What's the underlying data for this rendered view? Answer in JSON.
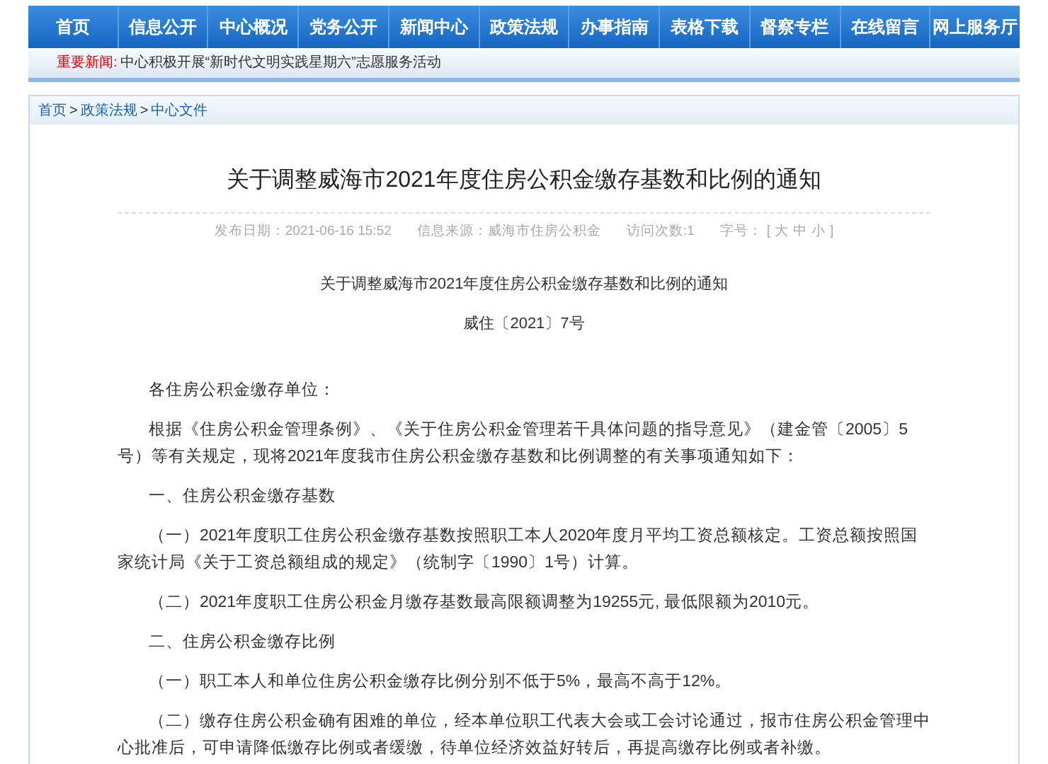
{
  "nav": [
    {
      "label": "首页"
    },
    {
      "label": "信息公开"
    },
    {
      "label": "中心概况"
    },
    {
      "label": "党务公开"
    },
    {
      "label": "新闻中心"
    },
    {
      "label": "政策法规"
    },
    {
      "label": "办事指南"
    },
    {
      "label": "表格下载"
    },
    {
      "label": "督察专栏"
    },
    {
      "label": "在线留言"
    },
    {
      "label": "网上服务厅"
    }
  ],
  "news": {
    "label": "重要新闻:",
    "headline": "中心积极开展“新时代文明实践星期六”志愿服务活动"
  },
  "breadcrumb": [
    {
      "label": "首页"
    },
    {
      "label": "政策法规"
    },
    {
      "label": "中心文件"
    }
  ],
  "breadcrumb_separator": ">",
  "article": {
    "title": "关于调整威海市2021年度住房公积金缴存基数和比例的通知",
    "meta": [
      "发布日期：2021-06-16 15:52",
      "信息来源：威海市住房公积金",
      "访问次数:1"
    ],
    "font_size": {
      "label": "字号：",
      "options": [
        "[",
        "大",
        "中",
        "小",
        "]"
      ]
    },
    "subtitle": "关于调整威海市2021年度住房公积金缴存基数和比例的通知",
    "doc_number": "威住〔2021〕7号",
    "paragraphs": [
      "各住房公积金缴存单位：",
      "根据《住房公积金管理条例》、《关于住房公积金管理若干具体问题的指导意见》（建金管〔2005〕5号）等有关规定，现将2021年度我市住房公积金缴存基数和比例调整的有关事项通知如下：",
      "一、住房公积金缴存基数",
      "（一）2021年度职工住房公积金缴存基数按照职工本人2020年度月平均工资总额核定。工资总额按照国家统计局《关于工资总额组成的规定》（统制字〔1990〕1号）计算。",
      "（二）2021年度职工住房公积金月缴存基数最高限额调整为19255元, 最低限额为2010元。",
      "二、住房公积金缴存比例",
      "（一）职工本人和单位住房公积金缴存比例分别不低于5%，最高不高于12%。",
      "（二）缴存住房公积金确有困难的单位，经本单位职工代表大会或工会讨论通过，报市住房公积金管理中心批准后，可申请降低缴存比例或者缓缴，待单位经济效益好转后，再提高缴存比例或者补缴。"
    ]
  }
}
